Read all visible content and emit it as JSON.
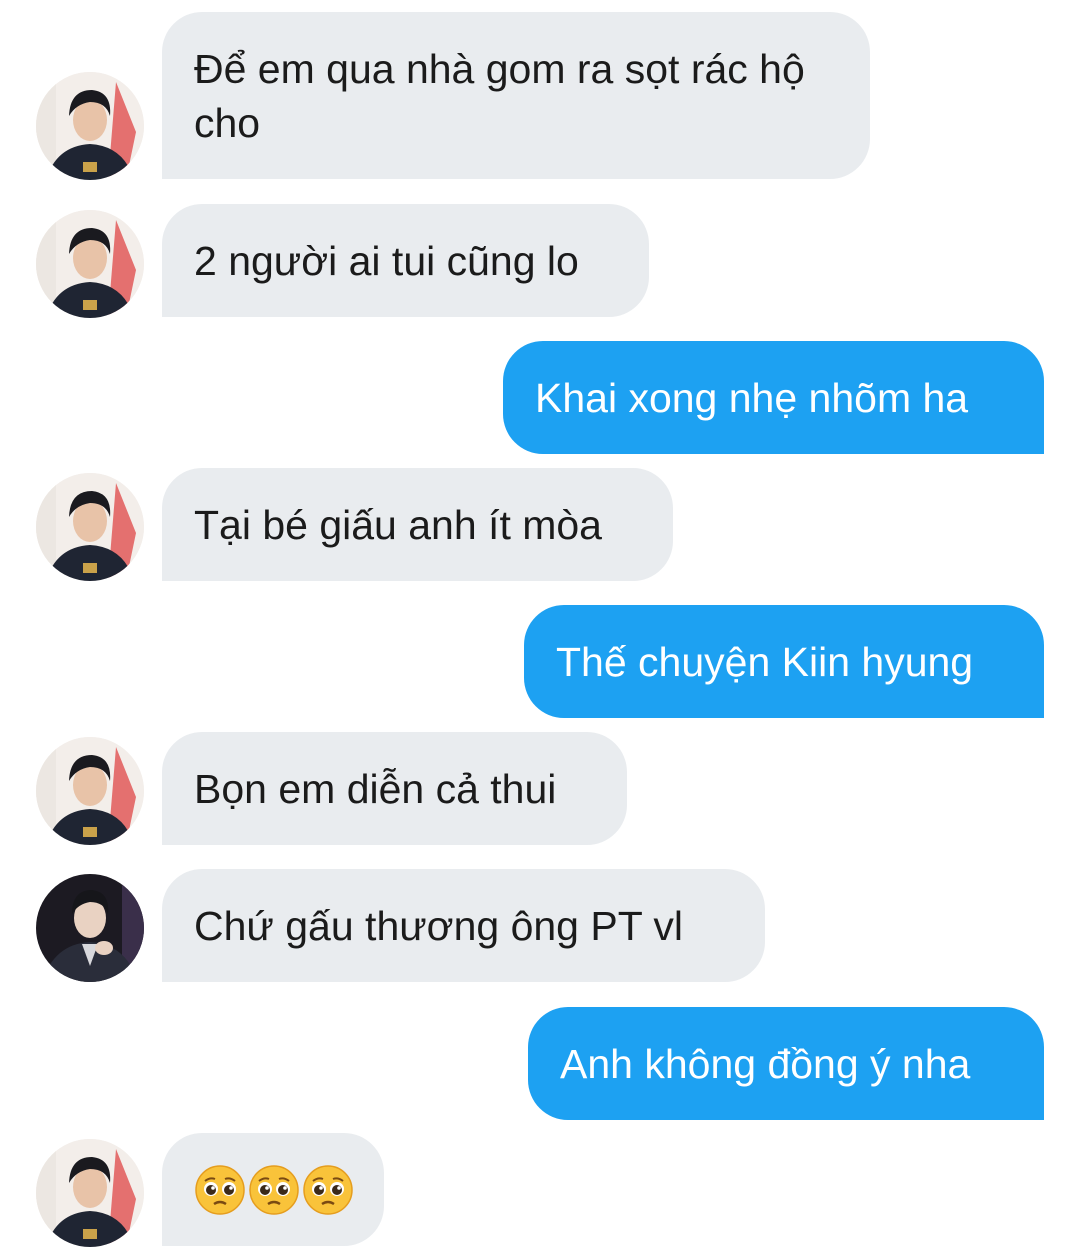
{
  "messages": [
    {
      "id": "m1",
      "direction": "incoming",
      "avatar": "avatar-boy-smiling",
      "text": "Để em qua nhà gom ra sọt rác hộ cho"
    },
    {
      "id": "m2",
      "direction": "incoming",
      "avatar": "avatar-boy-smiling",
      "text": "2 người ai tui cũng lo"
    },
    {
      "id": "m3",
      "direction": "outgoing",
      "text": "Khai xong nhẹ nhõm ha"
    },
    {
      "id": "m4",
      "direction": "incoming",
      "avatar": "avatar-boy-smiling",
      "text": "Tại bé giấu anh ít mòa"
    },
    {
      "id": "m5",
      "direction": "outgoing",
      "text": "Thế chuyện Kiin hyung"
    },
    {
      "id": "m6",
      "direction": "incoming",
      "avatar": "avatar-boy-smiling",
      "text": "Bọn em diễn cả thui"
    },
    {
      "id": "m7",
      "direction": "incoming",
      "avatar": "avatar-suit-man",
      "text": "Chứ gấu thương ông PT vl"
    },
    {
      "id": "m8",
      "direction": "outgoing",
      "text": "Anh không đồng ý nha"
    },
    {
      "id": "m9",
      "direction": "incoming",
      "avatar": "avatar-boy-smiling",
      "emoji": [
        "pleading-face",
        "pleading-face",
        "pleading-face"
      ]
    }
  ],
  "colors": {
    "incoming_bg": "#e9ecef",
    "outgoing_bg": "#1da1f2",
    "incoming_text": "#1b1b1b",
    "outgoing_text": "#ffffff"
  }
}
